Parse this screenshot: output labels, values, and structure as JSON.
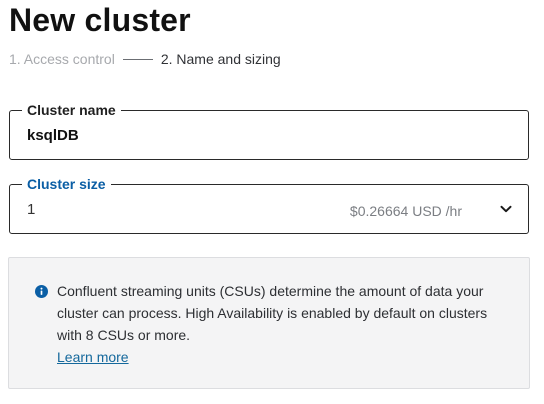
{
  "page": {
    "title": "New cluster"
  },
  "steps": [
    {
      "label": "1. Access control",
      "active": false
    },
    {
      "label": "2. Name and sizing",
      "active": true
    }
  ],
  "cluster_name": {
    "label": "Cluster name",
    "value": "ksqlDB"
  },
  "cluster_size": {
    "label": "Cluster size",
    "value": "1",
    "price": "$0.26664 USD /hr",
    "icon": "chevron-down-icon"
  },
  "info": {
    "icon": "info-icon",
    "text": "Confluent streaming units (CSUs) determine the amount of data your cluster can process. High Availability is enabled by default on clusters with 8 CSUs or more.",
    "link": "Learn more"
  },
  "colors": {
    "accent": "#0a5ea5",
    "link": "#14689c",
    "info_background": "#f4f4f5"
  }
}
